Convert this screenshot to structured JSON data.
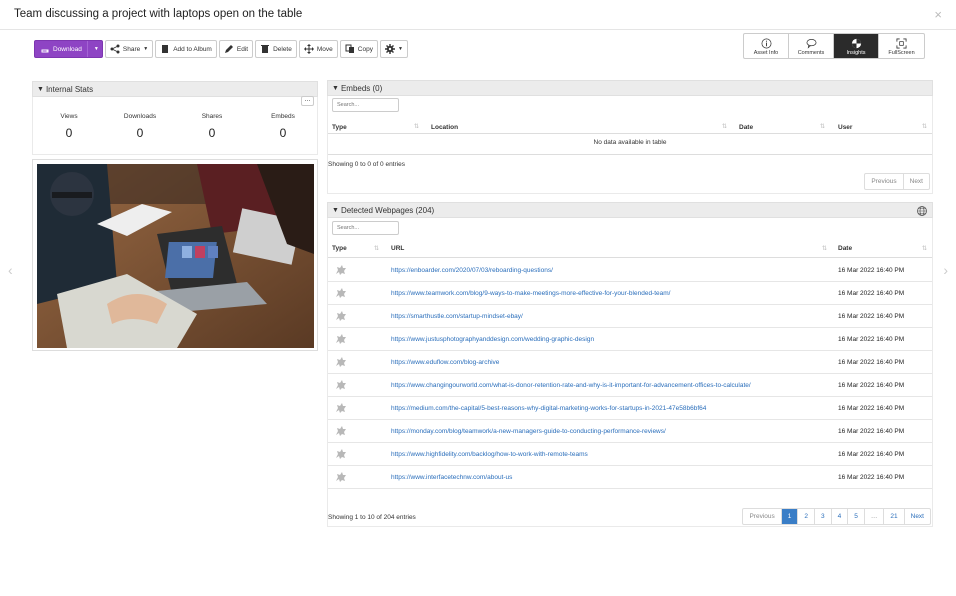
{
  "title": "Team discussing a project with laptops open on the table",
  "close_glyph": "×",
  "toolbar": {
    "download": "Download",
    "share": "Share",
    "add_to_album": "Add to Album",
    "edit": "Edit",
    "delete": "Delete",
    "move": "Move",
    "copy": "Copy"
  },
  "right_tabs": [
    "Asset Info",
    "Comments",
    "Insights",
    "FullScreen"
  ],
  "stats": {
    "header": "Internal Stats",
    "more": "...",
    "items": [
      {
        "label": "Views",
        "value": "0"
      },
      {
        "label": "Downloads",
        "value": "0"
      },
      {
        "label": "Shares",
        "value": "0"
      },
      {
        "label": "Embeds",
        "value": "0"
      }
    ]
  },
  "embeds": {
    "header": "Embeds (0)",
    "search_placeholder": "Search...",
    "columns": [
      "Type",
      "Location",
      "Date",
      "User"
    ],
    "empty": "No data available in table",
    "info": "Showing 0 to 0 of 0 entries",
    "prev": "Previous",
    "next": "Next"
  },
  "webpages": {
    "header": "Detected Webpages (204)",
    "search_placeholder": "Search...",
    "columns": [
      "Type",
      "URL",
      "Date"
    ],
    "rows": [
      {
        "url": "https://enboarder.com/2020/07/03/reboarding-questions/",
        "date": "16 Mar 2022 16:40 PM"
      },
      {
        "url": "https://www.teamwork.com/blog/9-ways-to-make-meetings-more-effective-for-your-blended-team/",
        "date": "16 Mar 2022 16:40 PM"
      },
      {
        "url": "https://smarthustle.com/startup-mindset-ebay/",
        "date": "16 Mar 2022 16:40 PM"
      },
      {
        "url": "https://www.justusphotographyanddesign.com/wedding-graphic-design",
        "date": "16 Mar 2022 16:40 PM"
      },
      {
        "url": "https://www.eduflow.com/blog-archive",
        "date": "16 Mar 2022 16:40 PM"
      },
      {
        "url": "https://www.changingourworld.com/what-is-donor-retention-rate-and-why-is-it-important-for-advancement-offices-to-calculate/",
        "date": "16 Mar 2022 16:40 PM"
      },
      {
        "url": "https://medium.com/the-capital/5-best-reasons-why-digital-marketing-works-for-startups-in-2021-47e58b6bf64",
        "date": "16 Mar 2022 16:40 PM"
      },
      {
        "url": "https://monday.com/blog/teamwork/a-new-managers-guide-to-conducting-performance-reviews/",
        "date": "16 Mar 2022 16:40 PM"
      },
      {
        "url": "https://www.highfidelity.com/backlog/how-to-work-with-remote-teams",
        "date": "16 Mar 2022 16:40 PM"
      },
      {
        "url": "https://www.interfacetechnw.com/about-us",
        "date": "16 Mar 2022 16:40 PM"
      }
    ],
    "info": "Showing 1 to 10 of 204 entries",
    "pager": [
      "Previous",
      "1",
      "2",
      "3",
      "4",
      "5",
      "…",
      "21",
      "Next"
    ]
  },
  "nav": {
    "prev": "‹",
    "next": "›"
  }
}
